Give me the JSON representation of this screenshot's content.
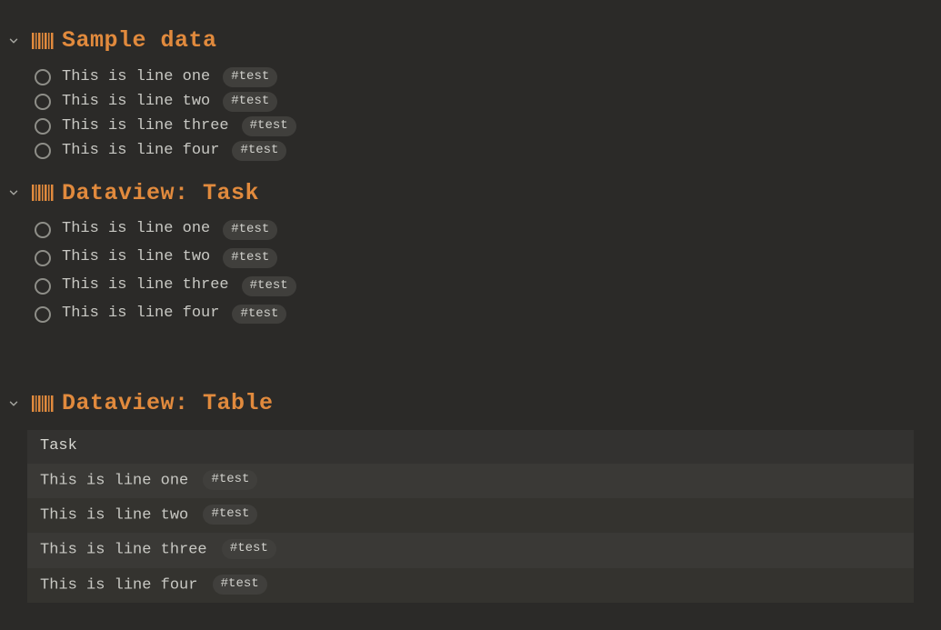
{
  "sections": {
    "sample": {
      "title": "Sample data",
      "items": [
        {
          "text": "This is line one",
          "tag": "#test"
        },
        {
          "text": "This is line two",
          "tag": "#test"
        },
        {
          "text": "This is line three",
          "tag": "#test"
        },
        {
          "text": "This is line four",
          "tag": "#test"
        }
      ]
    },
    "task": {
      "title": "Dataview: Task",
      "items": [
        {
          "text": "This is line one",
          "tag": "#test"
        },
        {
          "text": "This is line two",
          "tag": "#test"
        },
        {
          "text": "This is line three",
          "tag": "#test"
        },
        {
          "text": "This is line four",
          "tag": "#test"
        }
      ]
    },
    "table": {
      "title": "Dataview: Table",
      "header": "Task",
      "rows": [
        {
          "text": "This is line one",
          "tag": "#test"
        },
        {
          "text": "This is line two",
          "tag": "#test"
        },
        {
          "text": "This is line three",
          "tag": "#test"
        },
        {
          "text": "This is line four",
          "tag": "#test"
        }
      ]
    }
  }
}
